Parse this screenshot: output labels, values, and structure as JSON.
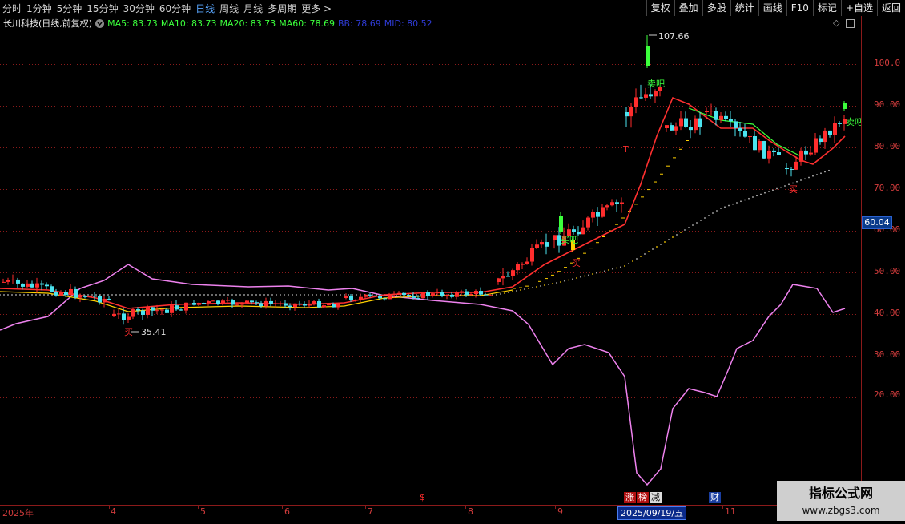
{
  "toolbar": {
    "periods": [
      "分时",
      "1分钟",
      "5分钟",
      "15分钟",
      "30分钟",
      "60分钟",
      "日线",
      "周线",
      "月线",
      "多周期",
      "更多 >"
    ],
    "active_period": "日线",
    "right_buttons": [
      "复权",
      "叠加",
      "多股",
      "统计",
      "画线",
      "F10",
      "标记",
      "+自选",
      "返回"
    ]
  },
  "info": {
    "title": "长川科技(日线,前复权)",
    "dropdown_icon": "chevron-down-icon",
    "ma5": "MA5: 83.73",
    "ma10": "MA10: 83.73",
    "ma20": "MA20: 83.73",
    "ma60": "MA60: 78.69",
    "bb": "BB: 78.69",
    "mid": "MID: 80.52"
  },
  "axis": {
    "labels": [
      "100.0",
      "90.00",
      "80.00",
      "70.00",
      "60.00",
      "50.00",
      "40.00",
      "30.00",
      "20.00"
    ],
    "current_tag": "60.04"
  },
  "dates": {
    "labels": [
      "2025年",
      "4",
      "5",
      "6",
      "7",
      "8",
      "9",
      "11"
    ],
    "cursor_date": "2025/09/19/五"
  },
  "events": {
    "dollar": "$",
    "zhang_label": "涨",
    "bang_label": "榜",
    "jian_label": "减",
    "cai_label": "财"
  },
  "annotations": {
    "high_label": "107.66",
    "low_label": "35.41",
    "sell_label": "卖吧",
    "buy_label": "买",
    "t_label": "T",
    "yellow_buy": "买吧"
  },
  "colors": {
    "up": "#ff2d2d",
    "down": "#4be4f0",
    "ma_red": "#ff3030",
    "ma_yellow": "#ffd000",
    "ma_green": "#3cff3c",
    "violet": "#ee82ee",
    "grid": "#8b1a1a"
  },
  "chart_data": {
    "type": "candlestick",
    "price_axis": [
      20,
      108
    ],
    "key_points": [
      {
        "label": "low",
        "value": 35.41
      },
      {
        "label": "high",
        "value": 107.66
      },
      {
        "label": "last",
        "value": 90.5
      }
    ],
    "ma_values": {
      "MA5": 83.73,
      "MA10": 83.73,
      "MA20": 83.73,
      "MA60": 78.69,
      "BB": 78.69,
      "MID": 80.52
    }
  }
}
